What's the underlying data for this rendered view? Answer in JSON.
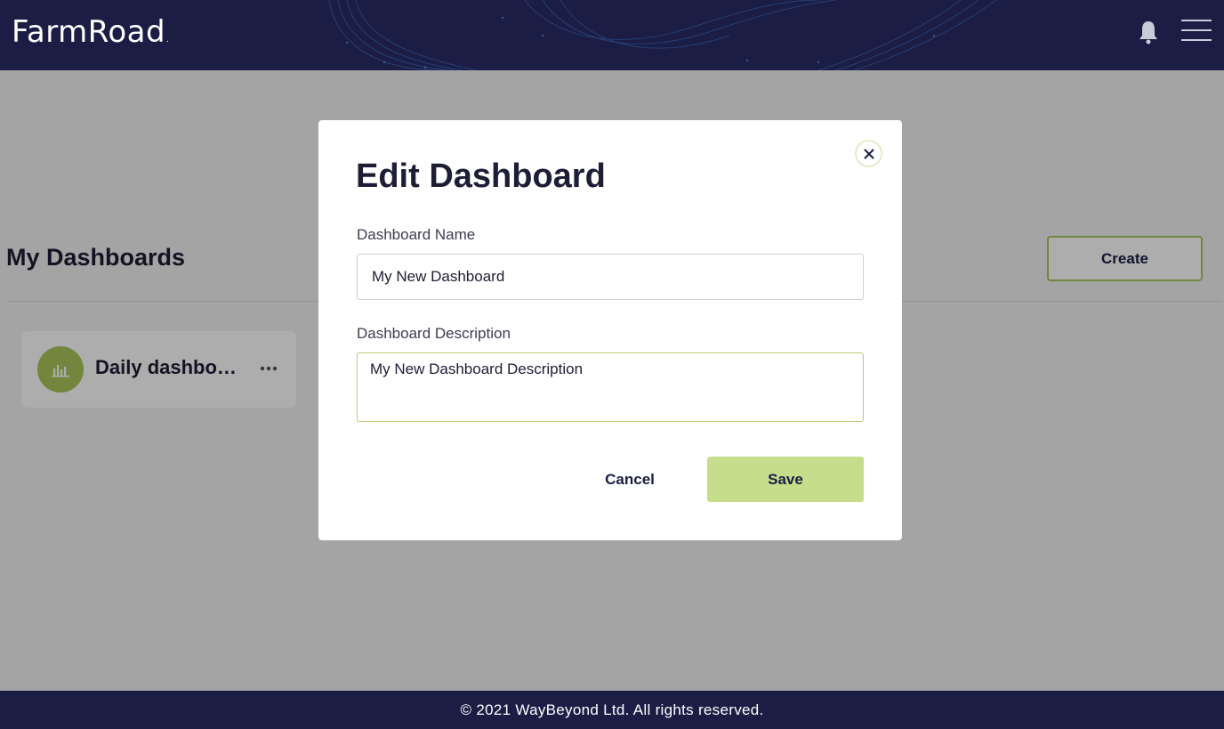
{
  "header": {
    "logo_text": "FarmRoad",
    "logo_mark": ".",
    "icons": [
      "bell-icon",
      "hamburger-menu-icon"
    ]
  },
  "page": {
    "title": "My Dashboards",
    "create_label": "Create",
    "cards": [
      {
        "title": "Daily dashboard",
        "icon": "bar-chart-icon",
        "menu_icon": "more-horizontal-icon"
      }
    ]
  },
  "modal": {
    "title": "Edit Dashboard",
    "close_icon": "close-icon",
    "name_label": "Dashboard Name",
    "name_value": "My New Dashboard",
    "description_label": "Dashboard Description",
    "description_value": "My New Dashboard Description",
    "cancel_label": "Cancel",
    "save_label": "Save"
  },
  "footer": {
    "copyright": "© 2021 WayBeyond Ltd. All rights reserved."
  },
  "colors": {
    "navy": "#1b1d45",
    "accent_green": "#a8c85a",
    "save_green": "#c6dd8c",
    "page_background": "#f2f2f2"
  }
}
